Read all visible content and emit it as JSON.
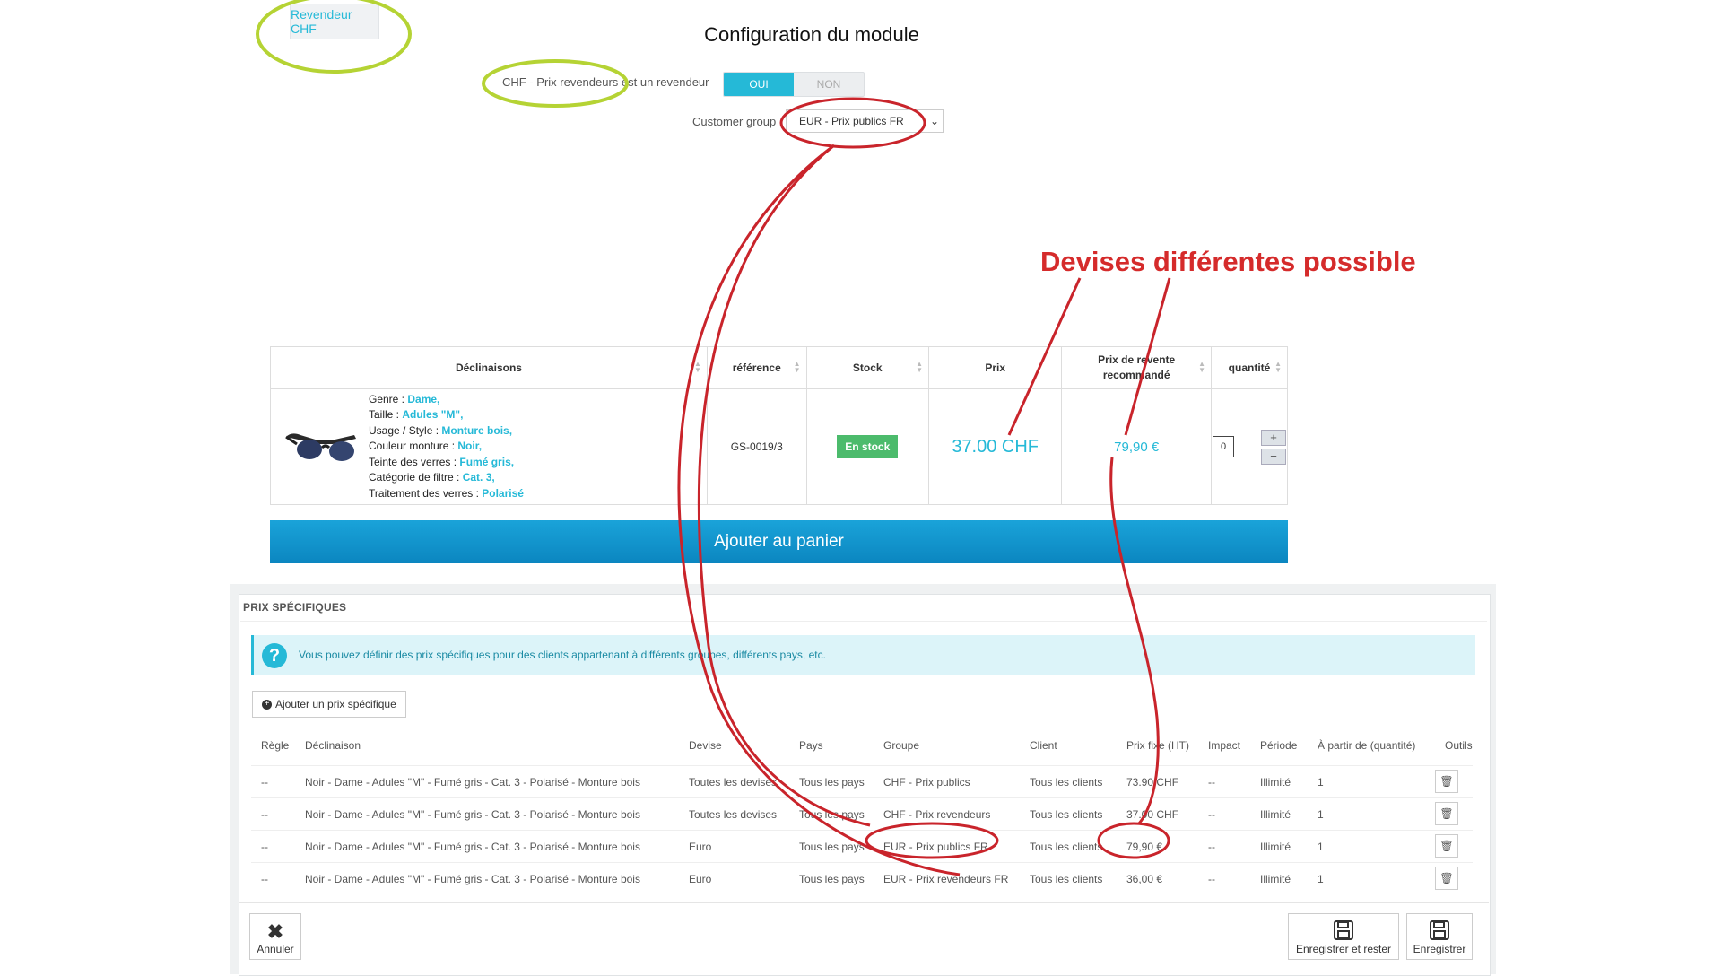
{
  "module": {
    "tab_label": "Revendeur CHF",
    "title": "Configuration du module",
    "switch_label": "CHF - Prix revendeurs est un revendeur",
    "switch_on": "OUI",
    "switch_off": "NON",
    "customer_group_label": "Customer group",
    "customer_group_value": "EUR - Prix publics FR"
  },
  "callout": "Devises différentes possible",
  "product_table": {
    "headers": [
      "Déclinaisons",
      "référence",
      "Stock",
      "Prix",
      "Prix de revente recommandé",
      "quantité"
    ],
    "attributes": [
      {
        "label": "Genre : ",
        "value": "Dame,"
      },
      {
        "label": "Taille : ",
        "value": "Adules \"M\","
      },
      {
        "label": "Usage / Style : ",
        "value": "Monture bois,"
      },
      {
        "label": "Couleur monture : ",
        "value": "Noir,"
      },
      {
        "label": "Teinte des verres : ",
        "value": "Fumé gris,"
      },
      {
        "label": "Catégorie de filtre : ",
        "value": "Cat. 3,"
      },
      {
        "label": "Traitement des verres : ",
        "value": "Polarisé"
      }
    ],
    "reference": "GS-0019/3",
    "stock": "En stock",
    "price": "37.00 CHF",
    "recommended_price": "79,90 €",
    "quantity": "0"
  },
  "add_to_cart": "Ajouter au panier",
  "specific_prices": {
    "title": "PRIX SPÉCIFIQUES",
    "info": "Vous pouvez définir des prix spécifiques pour des clients appartenant à différents groupes, différents pays, etc.",
    "add_button": "Ajouter un prix spécifique",
    "columns": [
      "Règle",
      "Déclinaison",
      "Devise",
      "Pays",
      "Groupe",
      "Client",
      "Prix fixe (HT)",
      "Impact",
      "Période",
      "À partir de (quantité)",
      "Outils"
    ],
    "rows": [
      {
        "rule": "--",
        "decl": "Noir - Dame - Adules \"M\" - Fumé gris - Cat. 3 - Polarisé - Monture bois",
        "currency": "Toutes les devises",
        "country": "Tous les pays",
        "group": "CHF - Prix publics",
        "client": "Tous les clients",
        "price": "73.90 CHF",
        "impact": "--",
        "period": "Illimité",
        "from": "1"
      },
      {
        "rule": "--",
        "decl": "Noir - Dame - Adules \"M\" - Fumé gris - Cat. 3 - Polarisé - Monture bois",
        "currency": "Toutes les devises",
        "country": "Tous les pays",
        "group": "CHF - Prix revendeurs",
        "client": "Tous les clients",
        "price": "37.00 CHF",
        "impact": "--",
        "period": "Illimité",
        "from": "1"
      },
      {
        "rule": "--",
        "decl": "Noir - Dame - Adules \"M\" - Fumé gris - Cat. 3 - Polarisé - Monture bois",
        "currency": "Euro",
        "country": "Tous les pays",
        "group": "EUR - Prix publics FR",
        "client": "Tous les clients",
        "price": "79,90 €",
        "impact": "--",
        "period": "Illimité",
        "from": "1"
      },
      {
        "rule": "--",
        "decl": "Noir - Dame - Adules \"M\" - Fumé gris - Cat. 3 - Polarisé - Monture bois",
        "currency": "Euro",
        "country": "Tous les pays",
        "group": "EUR - Prix revendeurs FR",
        "client": "Tous les clients",
        "price": "36,00 €",
        "impact": "--",
        "period": "Illimité",
        "from": "1"
      }
    ]
  },
  "footer": {
    "cancel": "Annuler",
    "save_stay": "Enregistrer et rester",
    "save": "Enregistrer"
  },
  "colors": {
    "accent": "#25b9d7",
    "annotation_red": "#d52b2b",
    "annotation_green": "#b5d334",
    "stock_green": "#4cbb6c"
  }
}
